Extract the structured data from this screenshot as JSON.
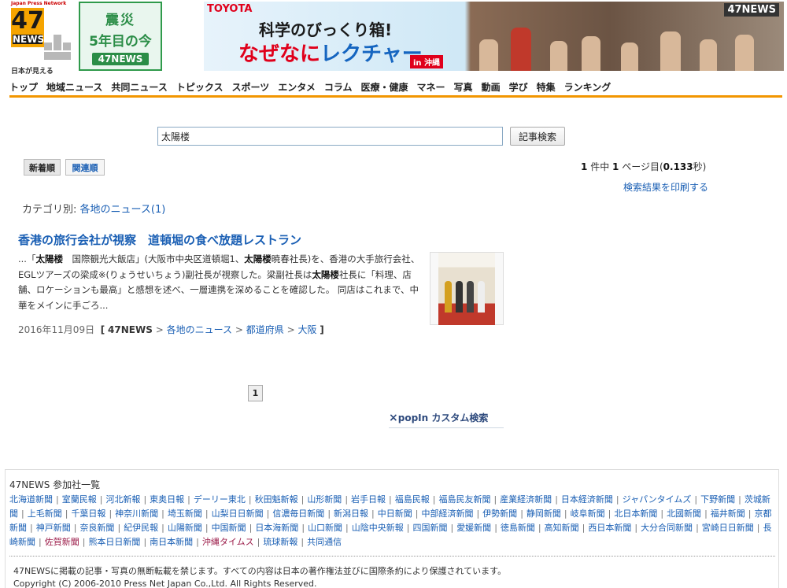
{
  "header": {
    "logo": {
      "top_text": "Japan Press Network",
      "number": "47",
      "word": "NEWS",
      "tagline": "日本が見える"
    },
    "shinsai": {
      "line1": "震災",
      "line2": "5年目の今",
      "line3": "47NEWS"
    },
    "banner": {
      "brand": "TOYOTA",
      "line1": "科学のびっくり箱!",
      "line2_a": "なぜなに",
      "line2_b": "レクチャー",
      "badge": "in 沖縄",
      "corner": "47NEWS"
    },
    "nav": [
      "トップ",
      "地域ニュース",
      "共同ニュース",
      "トピックス",
      "スポーツ",
      "エンタメ",
      "コラム",
      "医療・健康",
      "マネー",
      "写真",
      "動画",
      "学び",
      "特集",
      "ランキング"
    ]
  },
  "search": {
    "query": "太陽楼",
    "button": "記事検索"
  },
  "sort": {
    "newest": "新着順",
    "related": "関連順"
  },
  "results": {
    "count": "1",
    "count_label": "件中",
    "page": "1",
    "page_label": "ページ目(",
    "time": "0.133",
    "time_unit": "秒)",
    "print": "検索結果を印刷する"
  },
  "category": {
    "label": "カテゴリ別:",
    "value": "各地のニュース(1)"
  },
  "article": {
    "title": "香港の旅行会社が視察　道頓堀の食べ放題レストラン",
    "p1": "...「",
    "k1": "太陽楼",
    "p2": "　国際観光大飯店」(大阪市中央区道頓堀1、",
    "k2": "太陽楼",
    "p3": "暁春社長)を、香港の大手旅行会社、EGLツアーズの梁成※(りょうせいちょう)副社長が視察した。梁副社長は",
    "k3": "太陽楼",
    "p4": "社長に「料理、店舗、ロケーションも最高」と感想を述べ、一層連携を深めることを確認した。 同店はこれまで、中華をメインに手ごろ...",
    "date": "2016年11月09日",
    "breadcrumb": [
      "47NEWS",
      "各地のニュース",
      "都道府県",
      "大阪"
    ]
  },
  "pagination": {
    "current": "1"
  },
  "popin": {
    "icon": "×",
    "label": "popIn カスタム検索"
  },
  "footer": {
    "title": "47NEWS 参加社一覧",
    "partners": [
      "北海道新聞",
      "室蘭民報",
      "河北新報",
      "東奥日報",
      "デーリー東北",
      "秋田魁新報",
      "山形新聞",
      "岩手日報",
      "福島民報",
      "福島民友新聞",
      "産業経済新聞",
      "日本経済新聞",
      "ジャパンタイムズ",
      "下野新聞",
      "茨城新聞",
      "上毛新聞",
      "千葉日報",
      "神奈川新聞",
      "埼玉新聞",
      "山梨日日新聞",
      "信濃毎日新聞",
      "新潟日報",
      "中日新聞",
      "中部経済新聞",
      "伊勢新聞",
      "静岡新聞",
      "岐阜新聞",
      "北日本新聞",
      "北國新聞",
      "福井新聞",
      "京都新聞",
      "神戸新聞",
      "奈良新聞",
      "紀伊民報",
      "山陽新聞",
      "中国新聞",
      "日本海新聞",
      "山口新聞",
      "山陰中央新報",
      "四国新聞",
      "愛媛新聞",
      "徳島新聞",
      "高知新聞",
      "西日本新聞",
      "大分合同新聞",
      "宮崎日日新聞",
      "長崎新聞",
      "佐賀新聞",
      "熊本日日新聞",
      "南日本新聞",
      "沖縄タイムス",
      "琉球新報",
      "共同通信"
    ],
    "red_partners": [
      "佐賀新聞",
      "沖縄タイムス"
    ],
    "notice": "47NEWSに掲載の記事・写真の無断転載を禁じます。すべての内容は日本の著作権法並びに国際条約により保護されています。",
    "copyright": "Copyright (C) 2006-2010 Press Net Japan Co.,Ltd. All Rights Reserved."
  }
}
